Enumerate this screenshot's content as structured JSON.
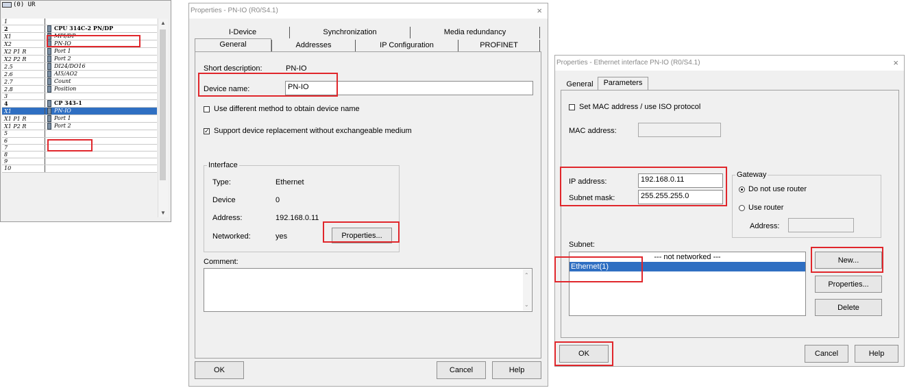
{
  "rack": {
    "title": "(0) UR",
    "rows": [
      {
        "slot": "1",
        "module": "",
        "bold": false,
        "sel": false,
        "icon": false
      },
      {
        "slot": "2",
        "module": "CPU 314C-2 PN/DP",
        "bold": true,
        "sel": false,
        "icon": true
      },
      {
        "slot": "X1",
        "module": "MPI/DP",
        "bold": false,
        "sel": false,
        "icon": true
      },
      {
        "slot": "X2",
        "module": "PN-IO",
        "bold": false,
        "sel": false,
        "icon": true
      },
      {
        "slot": "X2 P1 R",
        "module": "Port 1",
        "bold": false,
        "sel": false,
        "icon": true
      },
      {
        "slot": "X2 P2 R",
        "module": "Port 2",
        "bold": false,
        "sel": false,
        "icon": true
      },
      {
        "slot": "2.5",
        "module": "DI24/DO16",
        "bold": false,
        "sel": false,
        "icon": true
      },
      {
        "slot": "2.6",
        "module": "AI5/AO2",
        "bold": false,
        "sel": false,
        "icon": true
      },
      {
        "slot": "2.7",
        "module": "Count",
        "bold": false,
        "sel": false,
        "icon": true
      },
      {
        "slot": "2.8",
        "module": "Position",
        "bold": false,
        "sel": false,
        "icon": true
      },
      {
        "slot": "3",
        "module": "",
        "bold": false,
        "sel": false,
        "icon": false
      },
      {
        "slot": "4",
        "module": "CP 343-1",
        "bold": true,
        "sel": false,
        "icon": true
      },
      {
        "slot": "X1",
        "module": "PN-IO",
        "bold": false,
        "sel": true,
        "icon": true
      },
      {
        "slot": "X1 P1 R",
        "module": "Port 1",
        "bold": false,
        "sel": false,
        "icon": true
      },
      {
        "slot": "X1 P2 R",
        "module": "Port 2",
        "bold": false,
        "sel": false,
        "icon": true
      },
      {
        "slot": "5",
        "module": "",
        "bold": false,
        "sel": false,
        "icon": false
      },
      {
        "slot": "6",
        "module": "",
        "bold": false,
        "sel": false,
        "icon": false
      },
      {
        "slot": "7",
        "module": "",
        "bold": false,
        "sel": false,
        "icon": false
      },
      {
        "slot": "8",
        "module": "",
        "bold": false,
        "sel": false,
        "icon": false
      },
      {
        "slot": "9",
        "module": "",
        "bold": false,
        "sel": false,
        "icon": false
      },
      {
        "slot": "10",
        "module": "",
        "bold": false,
        "sel": false,
        "icon": false
      }
    ]
  },
  "pnio": {
    "title": "Properties - PN-IO (R0/S4.1)",
    "close": "×",
    "tabs_back": [
      "I-Device",
      "Synchronization",
      "Media redundancy"
    ],
    "tabs_front": [
      "General",
      "Addresses",
      "IP Configuration",
      "PROFINET"
    ],
    "short_desc_label": "Short description:",
    "short_desc_value": "PN-IO",
    "device_name_label": "Device name:",
    "device_name_value": "PN-IO",
    "chk_diff_method": "Use different method to obtain device name",
    "chk_support": "Support device replacement without exchangeable medium",
    "chk_support_mark": "✓",
    "interface_legend": "Interface",
    "type_label": "Type:",
    "type_value": "Ethernet",
    "device_label": "Device",
    "device_value": "0",
    "address_label": "Address:",
    "address_value": "192.168.0.11",
    "networked_label": "Networked:",
    "networked_value": "yes",
    "properties_btn": "Properties...",
    "comment_label": "Comment:",
    "ok_btn": "OK",
    "cancel_btn": "Cancel",
    "help_btn": "Help"
  },
  "eth": {
    "title": "Properties - Ethernet interface  PN-IO (R0/S4.1)",
    "close": "×",
    "tabs": [
      "General",
      "Parameters"
    ],
    "chk_mac": "Set MAC address / use ISO protocol",
    "mac_label": "MAC address:",
    "ip_label": "IP address:",
    "ip_value": "192.168.0.11",
    "subnet_label": "Subnet mask:",
    "subnet_value": "255.255.255.0",
    "gateway_legend": "Gateway",
    "radio_no_router": "Do not use router",
    "radio_use_router": "Use router",
    "gw_address_label": "Address:",
    "subnet_list_label": "Subnet:",
    "subnet_items": [
      "--- not networked ---",
      "Ethernet(1)"
    ],
    "new_btn": "New...",
    "properties_btn": "Properties...",
    "delete_btn": "Delete",
    "ok_btn": "OK",
    "cancel_btn": "Cancel",
    "help_btn": "Help"
  },
  "colors": {
    "highlight": "#e0262b",
    "selection": "#2f6fc2"
  }
}
